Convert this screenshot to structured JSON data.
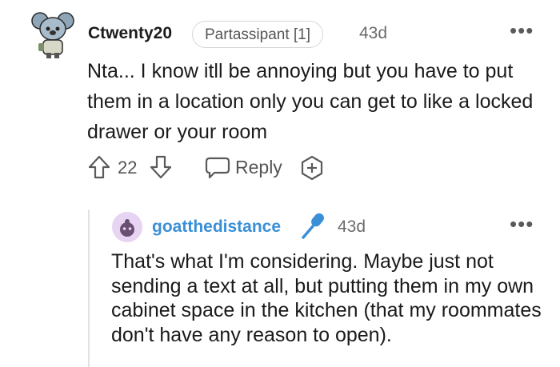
{
  "comment": {
    "author": "Ctwenty20",
    "flair": "Partassipant [1]",
    "age": "43d",
    "more_label": "•••",
    "body": "Nta... I know itll be annoying but you have to put them in a location only you can get to like a locked drawer or your room",
    "actions": {
      "score": "22",
      "reply_label": "Reply",
      "upvote_icon": "upvote-arrow-icon",
      "downvote_icon": "downvote-arrow-icon",
      "reply_icon": "speech-bubble-icon",
      "award_icon": "award-plus-icon"
    }
  },
  "reply": {
    "author": "goatthedistance",
    "age": "43d",
    "more_label": "•••",
    "badge_icon": "microphone-icon",
    "body": "That's what I'm considering. Maybe just not sending a text at all, but putting them in my own cabinet space in the kitchen (that my roommates don't have any reason to open)."
  },
  "colors": {
    "author_link": "#3a8fd6",
    "muted": "#6b6b6b",
    "flair_border": "#d6d6d6",
    "thread_line": "#e2e2e2",
    "avatar_bg": "#e6d4f2"
  }
}
